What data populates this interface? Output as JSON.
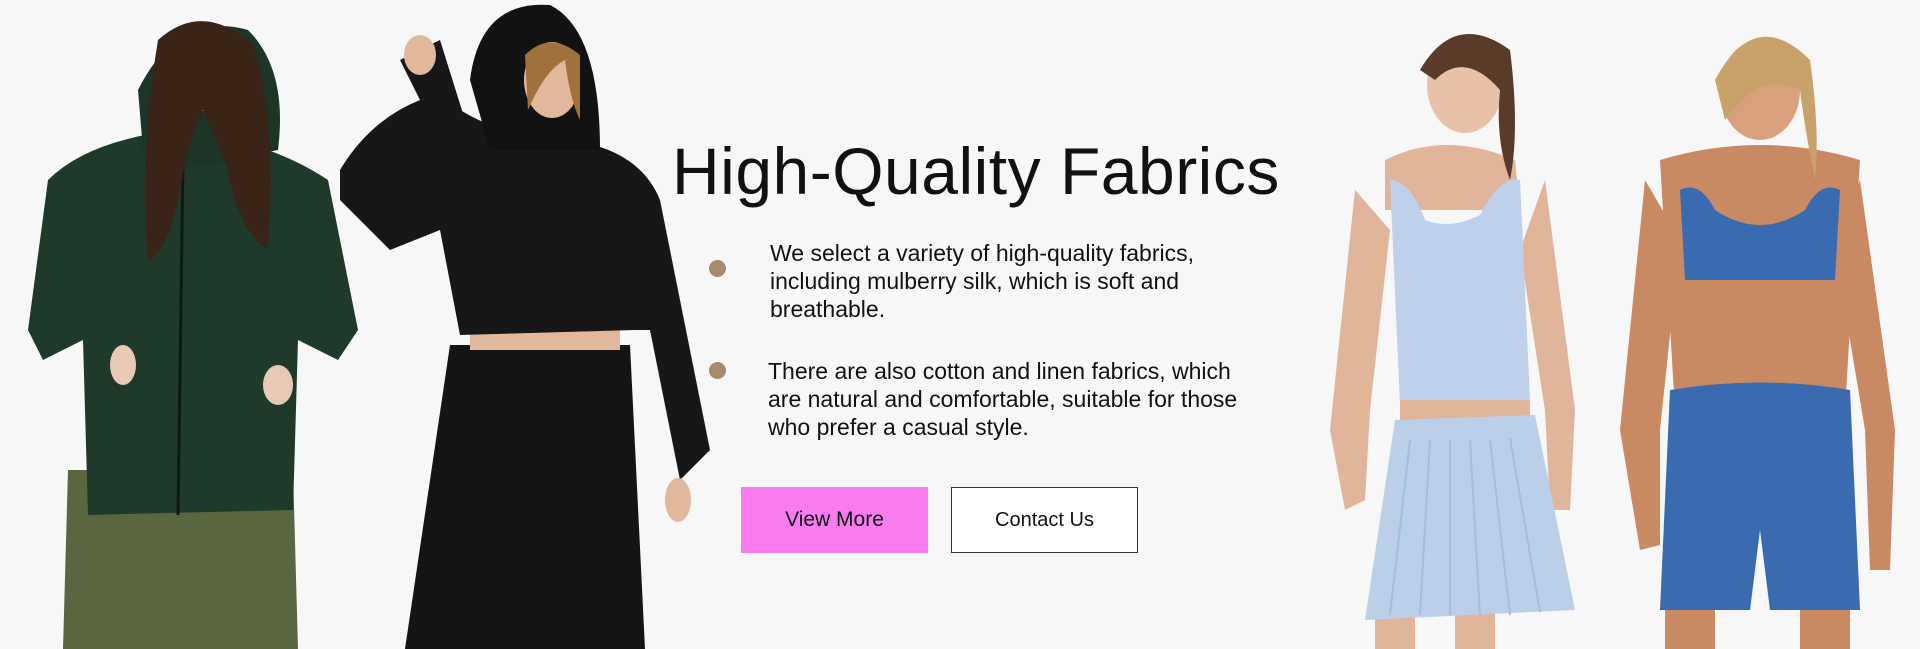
{
  "banner": {
    "title": "High-Quality Fabrics",
    "points": [
      "We select a variety of high-quality fabrics, including mulberry silk, which is soft and breathable.",
      "There are also cotton and linen fabrics, which are natural and comfortable, suitable for those who prefer a casual style."
    ],
    "buttons": {
      "view_more": "View More",
      "contact_us": "Contact Us"
    }
  },
  "colors": {
    "background": "#f7f7f8",
    "bullet": "#a68a6b",
    "view_more_button": "#f87cf0",
    "green_hoodie": "#1f3a2a",
    "black_set": "#141414",
    "light_blue_set": "#bccfe8",
    "blue_set": "#3a6bb0"
  }
}
